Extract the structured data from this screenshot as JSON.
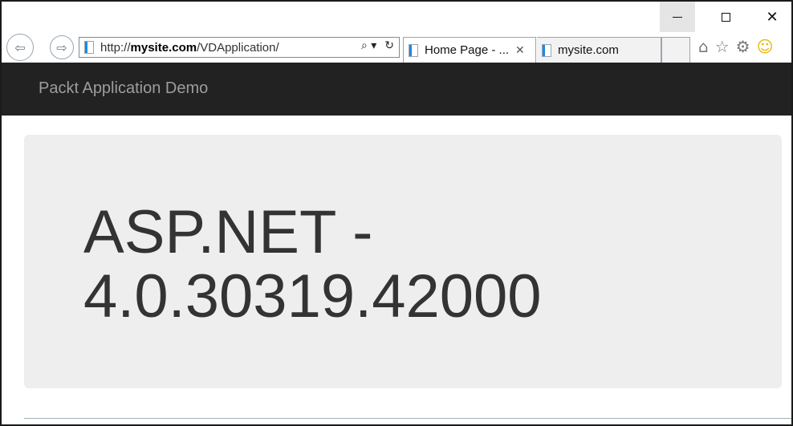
{
  "window": {
    "minimize_glyph": "—",
    "maximize_glyph": "□",
    "close_glyph": "✕"
  },
  "nav": {
    "back_glyph": "⇦",
    "forward_glyph": "⇨"
  },
  "address": {
    "url_prefix": "http://",
    "url_host": "mysite.com",
    "url_path": "/VDApplication/",
    "search_glyph": "⌕ ▾",
    "refresh_glyph": "↻"
  },
  "tabs": [
    {
      "label": "Home Page - ...",
      "close_glyph": "✕"
    },
    {
      "label": "mysite.com"
    }
  ],
  "toolbar": {
    "home_glyph": "⌂",
    "favorites_glyph": "☆",
    "settings_glyph": "⚙",
    "feedback_glyph": "☺"
  },
  "site": {
    "brand": "Packt Application Demo",
    "heading_line1": "ASP.NET -",
    "heading_line2": "4.0.30319.42000"
  },
  "colors": {
    "navbar_bg": "#222222",
    "brand_text": "#9d9d9d",
    "jumbotron_bg": "#eeeeee",
    "heading_text": "#333333"
  }
}
